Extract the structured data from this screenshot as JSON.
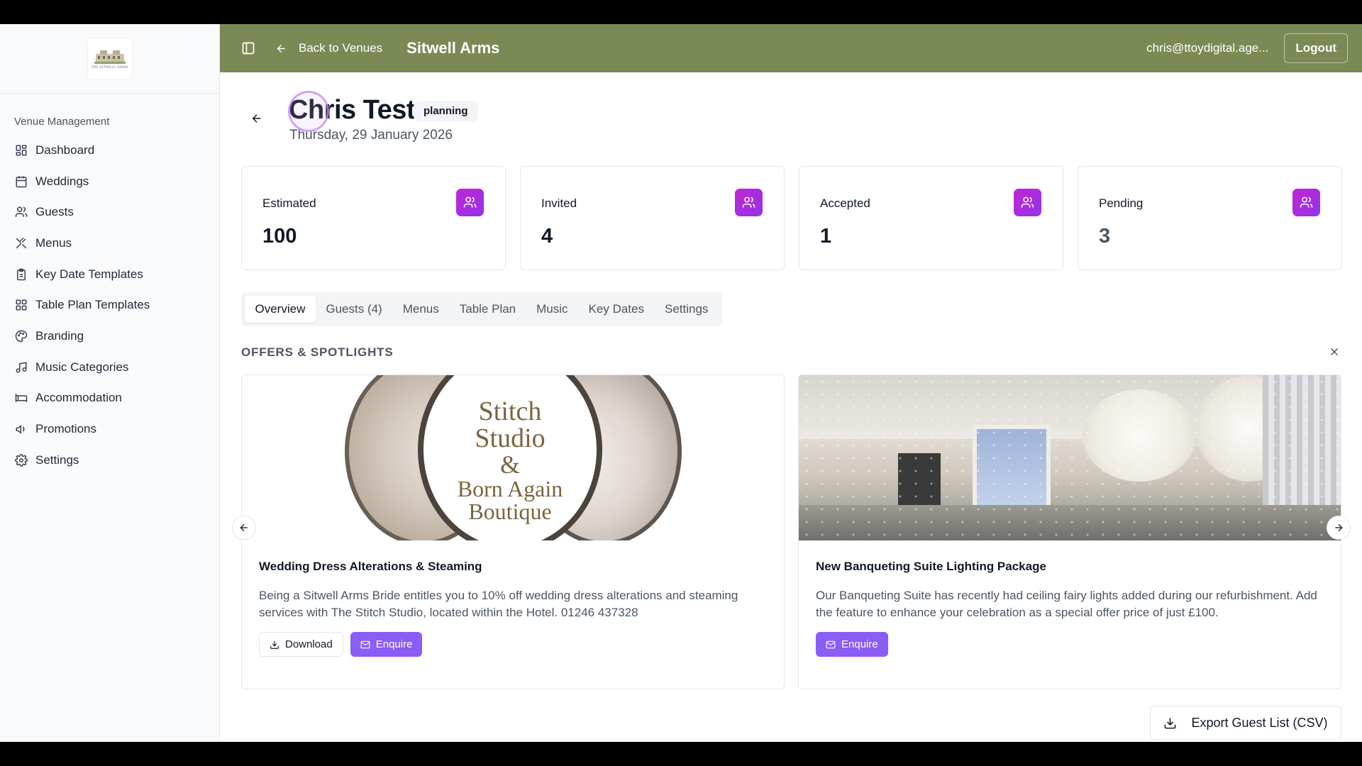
{
  "sidebar": {
    "logo_text": "THE SITWELL ARMS",
    "section_label": "Venue Management",
    "items": [
      {
        "label": "Dashboard",
        "icon": "dashboard-icon"
      },
      {
        "label": "Weddings",
        "icon": "calendar-icon"
      },
      {
        "label": "Guests",
        "icon": "users-icon"
      },
      {
        "label": "Menus",
        "icon": "utensils-icon"
      },
      {
        "label": "Key Date Templates",
        "icon": "clipboard-icon"
      },
      {
        "label": "Table Plan Templates",
        "icon": "grid-icon"
      },
      {
        "label": "Branding",
        "icon": "palette-icon"
      },
      {
        "label": "Music Categories",
        "icon": "music-icon"
      },
      {
        "label": "Accommodation",
        "icon": "bed-icon"
      },
      {
        "label": "Promotions",
        "icon": "megaphone-icon"
      },
      {
        "label": "Settings",
        "icon": "gear-icon"
      }
    ]
  },
  "topbar": {
    "back_label": "Back to Venues",
    "venue_name": "Sitwell Arms",
    "user_email": "chris@ttoydigital.age...",
    "logout_label": "Logout",
    "color": "#7b8a55"
  },
  "wedding": {
    "name": "Chris Test",
    "status": "planning",
    "date": "Thursday, 29 January 2026"
  },
  "stats": [
    {
      "label": "Estimated",
      "value": "100"
    },
    {
      "label": "Invited",
      "value": "4"
    },
    {
      "label": "Accepted",
      "value": "1"
    },
    {
      "label": "Pending",
      "value": "3"
    }
  ],
  "tabs": [
    {
      "label": "Overview",
      "active": true
    },
    {
      "label": "Guests (4)"
    },
    {
      "label": "Menus"
    },
    {
      "label": "Table Plan"
    },
    {
      "label": "Music"
    },
    {
      "label": "Key Dates"
    },
    {
      "label": "Settings"
    }
  ],
  "offers": {
    "section_title": "OFFERS & SPOTLIGHTS",
    "items": [
      {
        "brand_lines": [
          "Stitch",
          "Studio",
          "&",
          "Born Again",
          "Boutique"
        ],
        "title": "Wedding Dress Alterations & Steaming",
        "description": "Being a Sitwell Arms Bride entitles you to 10% off wedding dress alterations and steaming services with The Stitch Studio, located within the Hotel. 01246 437328",
        "download_label": "Download",
        "enquire_label": "Enquire"
      },
      {
        "title": "New Banqueting Suite Lighting Package",
        "description": "Our Banqueting Suite has recently had ceiling fairy lights added during our refurbishment. Add the feature to enhance your celebration as a special offer price of just £100.",
        "enquire_label": "Enquire"
      }
    ]
  },
  "export_label": "Export Guest List (CSV)",
  "accent_color": "#8b5cf6"
}
